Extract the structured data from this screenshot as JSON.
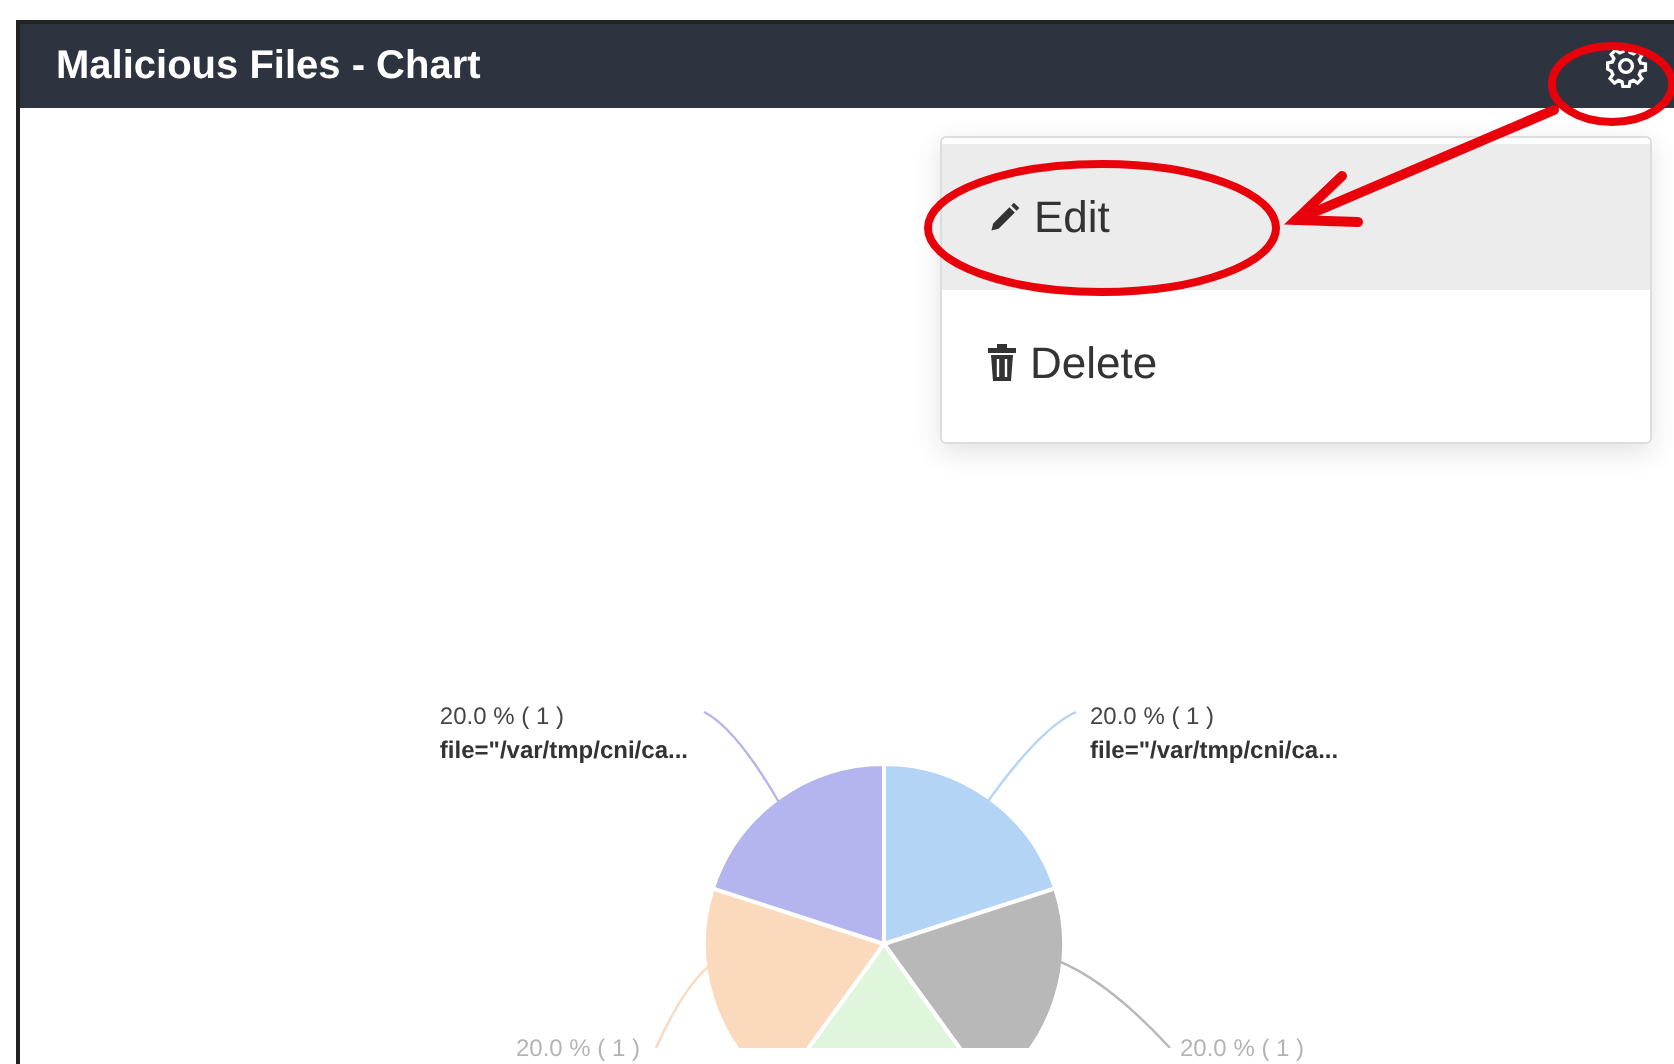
{
  "card": {
    "title": "Malicious Files - Chart"
  },
  "menu": {
    "items": [
      {
        "kind": "edit",
        "label": "Edit",
        "selected": true
      },
      {
        "kind": "delete",
        "label": "Delete",
        "selected": false
      }
    ]
  },
  "chart_data": {
    "type": "pie",
    "categories": [
      "file=\"/var/tmp/cni/ca...",
      null,
      null,
      null,
      "file=\"/var/tmp/cni/ca..."
    ],
    "values": [
      1,
      1,
      1,
      1,
      1
    ],
    "colors": [
      "#b3d4f5",
      "#b8b8b8",
      "#dff5dc",
      "#fbd9bd",
      "#b4b4ee"
    ],
    "value_labels": [
      "20.0 % ( 1 )",
      "20.0 % ( 1 )",
      null,
      "20.0 % ( 1 )",
      "20.0 % ( 1 )"
    ]
  }
}
